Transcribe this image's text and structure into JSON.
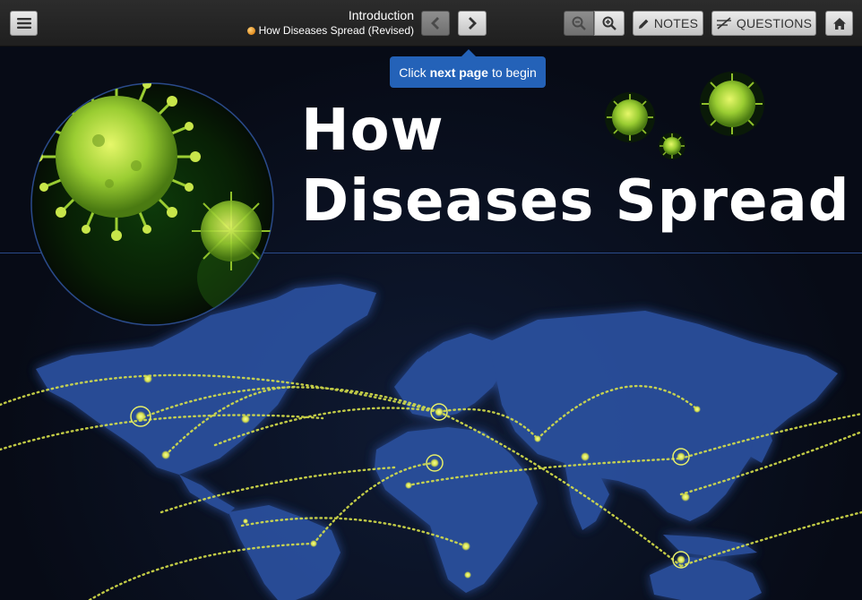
{
  "toolbar": {
    "section_title": "Introduction",
    "lesson_title": "How Diseases Spread (Revised)",
    "notes_label": "NOTES",
    "questions_label": "QUESTIONS"
  },
  "tooltip": {
    "prefix": "Click",
    "bold": "next page",
    "suffix": "to begin"
  },
  "slide": {
    "title_line1": "How",
    "title_line2": "Diseases Spread"
  },
  "colors": {
    "accent_blue": "#2462b8",
    "map_blue": "#2b4f9c",
    "route_yellow": "#d7e04a",
    "virus_green": "#9acd32"
  },
  "icons": [
    "hamburger-menu-icon",
    "chevron-left-icon",
    "chevron-right-icon",
    "zoom-out-icon",
    "zoom-in-icon",
    "pencil-icon",
    "questions-icon",
    "home-icon"
  ]
}
